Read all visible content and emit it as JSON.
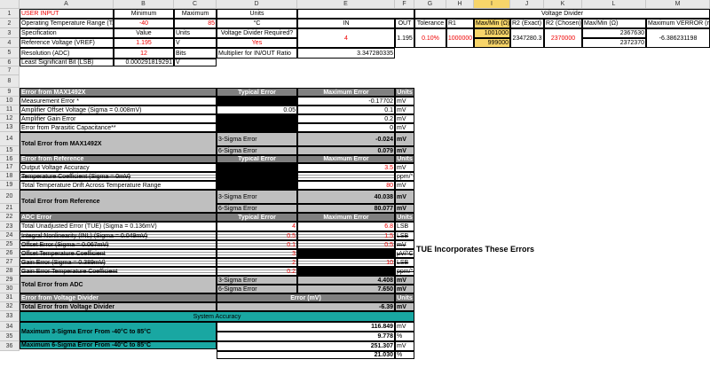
{
  "columns": [
    "A",
    "B",
    "C",
    "D",
    "E",
    "F",
    "G",
    "H",
    "I",
    "J",
    "K",
    "L",
    "M"
  ],
  "rows": [
    "1",
    "2",
    "3",
    "4",
    "5",
    "6",
    "7",
    "8",
    "9",
    "10",
    "11",
    "12",
    "13",
    "14",
    "15",
    "16",
    "17",
    "18",
    "19",
    "20",
    "21",
    "22",
    "23",
    "24",
    "25",
    "26",
    "27",
    "28",
    "29",
    "30",
    "31",
    "32",
    "33",
    "34",
    "35",
    "36"
  ],
  "selected_column": "I",
  "top": {
    "r1": {
      "a": "USER INPUT",
      "b": "Minimum",
      "c": "Maximum",
      "d": "Units",
      "gm": "Voltage Divider"
    },
    "r2": {
      "a": "Operating Temperature Range (TA)",
      "b": "-40",
      "c": "85",
      "d": "°C",
      "e": "IN",
      "f": "OUT",
      "g": "Tolerance",
      "h": "R1",
      "i": "Max/Min (Ω)",
      "j": "R2 (Exact)",
      "k": "R2 (Chosen)",
      "l": "Max/Min (Ω)",
      "m": "Maximum VERROR (mV)"
    },
    "r3": {
      "a": "Specification",
      "b": "Value",
      "c": "Units",
      "d": "Voltage Divider Required?",
      "i": "1001000"
    },
    "r4": {
      "a": "Reference Voltage (VREF)",
      "b": "1.195",
      "c": "V",
      "d": "Yes",
      "e": "4",
      "f": "1.195",
      "g": "0.10%",
      "h": "1000000",
      "i": "999000",
      "j": "2347280.3",
      "k": "2370000",
      "l1": "2367630",
      "l2": "2372370",
      "m": "-6.386231198"
    },
    "r5": {
      "a": "Resolution (ADC)",
      "b": "12",
      "c": "Bits",
      "d": "Multiplier for IN/OUT Ratio",
      "e": "3.347280335"
    },
    "r6": {
      "a": "Least Significant Bit (LSB)",
      "b": "0.000291819291",
      "c": "V"
    }
  },
  "s1": {
    "title": "Error from MAX1492X",
    "typical": "Typical Error",
    "maximum": "Maximum Error",
    "units": "Units",
    "items": [
      {
        "label": "Measurement Error *",
        "typ": "",
        "max": "-0.17702",
        "unit": "mV"
      },
      {
        "label": "Amplifier Offset Voltage (Sigma = 0.008mV)",
        "typ": "0.05",
        "max": "0.1",
        "unit": "mV"
      },
      {
        "label": "Amplifier Gain Error",
        "typ": "",
        "max": "0.2",
        "unit": "mV"
      },
      {
        "label": "Error from Parasitic Capacitance**",
        "typ": "",
        "max": "0",
        "unit": "mV"
      }
    ],
    "total": "Total Error from MAX1492X",
    "s3": "3-Sigma Error",
    "s3v": "-0.024",
    "s3u": "mV",
    "s6": "6-Sigma Error",
    "s6v": "0.079",
    "s6u": "mV"
  },
  "s2": {
    "title": "Error from Reference",
    "typical": "Typical Error",
    "maximum": "Maximum Error",
    "units": "Units",
    "items": [
      {
        "label": "Output Voltage Accuracy",
        "max": "3.5",
        "unit": "mV"
      },
      {
        "label": "Temperature Coefficient (Sigma = 0mV)",
        "max": "",
        "unit": "ppm/°C"
      },
      {
        "label": "Total Temperature Drift Across Temperature Range",
        "max": "80",
        "unit": "mV"
      }
    ],
    "total": "Total Error from Reference",
    "s3": "3-Sigma Error",
    "s3v": "40.038",
    "s3u": "mV",
    "s6": "6-Sigma Error",
    "s6v": "80.077",
    "s6u": "mV"
  },
  "s3": {
    "title": "ADC Error",
    "typical": "Typical Error",
    "maximum": "Maximum Error",
    "units": "Units",
    "items": [
      {
        "label": "Total Unadjusted Error (TUE) (Sigma = 0.136mV)",
        "typ": "4",
        "max": "6.8",
        "unit": "LSB"
      },
      {
        "label": "Integral Nonlinearity (INL) (Sigma = 0.049mV)",
        "typ": "0.5",
        "max": "1.5",
        "unit": "LSB"
      },
      {
        "label": "Offset Error (Sigma = 0.067mV)",
        "typ": "0.1",
        "max": "0.5",
        "unit": "mV"
      },
      {
        "label": "Offset Temperature Coefficient",
        "typ": "3",
        "max": "",
        "unit": "μV/°C"
      },
      {
        "label": "Gain Error (Sigma = 0.389mV)",
        "typ": "2",
        "max": "10",
        "unit": "LSB"
      },
      {
        "label": "Gain Error Temperature Coefficient",
        "typ": "0.2",
        "max": "",
        "unit": "ppm/°C"
      }
    ],
    "note": "TUE Incorporates These Errors",
    "total": "Total Error from ADC",
    "s3": "3-Sigma Error",
    "s3v": "4.408",
    "s3u": "mV",
    "s6": "6-Sigma Error",
    "s6v": "7.650",
    "s6u": "mV"
  },
  "s4": {
    "title": "Error from Voltage Divider",
    "col": "Error (mV)",
    "units": "Units",
    "total": "Total Error from Voltage Divider",
    "v": "-6.39",
    "u": "mV"
  },
  "s5": {
    "title": "System Accuracy",
    "r35": "Maximum 3-Sigma Error From -40°C to 85°C",
    "v35a": "116.849",
    "u35a": "mV",
    "v35b": "9.778",
    "u35b": "%",
    "r37": "Maximum 6-Sigma Error From -40°C to 85°C",
    "v37a": "251.307",
    "u37a": "mV",
    "v37b": "21.030",
    "u37b": "%"
  },
  "colors": {
    "accent_red": "#ee0000",
    "header_gray": "#808080",
    "teal": "#19a7a2",
    "selection": "#f7d56a"
  }
}
